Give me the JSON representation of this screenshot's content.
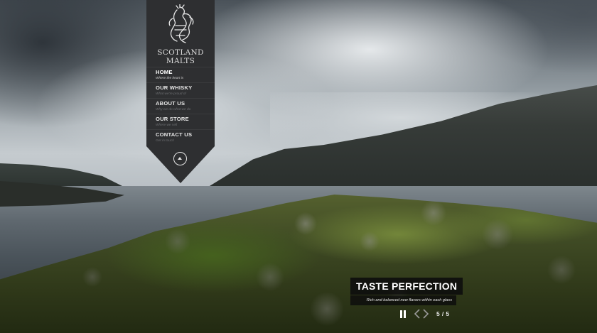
{
  "brand": {
    "name": "SCOTLAND MALTS",
    "emblem": "dragon-emblem"
  },
  "nav": {
    "items": [
      {
        "label": "HOME",
        "sub": "Where the heart is",
        "active": true
      },
      {
        "label": "OUR WHISKY",
        "sub": "What we're proud of",
        "active": false
      },
      {
        "label": "ABOUT US",
        "sub": "Why we do what we do",
        "active": false
      },
      {
        "label": "OUR STORE",
        "sub": "Where we sell",
        "active": false
      },
      {
        "label": "CONTACT US",
        "sub": "Get in touch",
        "active": false
      }
    ],
    "toggle_icon": "chevron-up-icon"
  },
  "slide": {
    "title": "TASTE PERFECTION",
    "subtitle": "Rich and balanced new flavors within each glass",
    "counter": "5 / 5",
    "current": 5,
    "total": 5
  },
  "controls": {
    "pause_icon": "pause-icon",
    "prev_icon": "chevron-left-icon",
    "next_icon": "chevron-right-icon"
  },
  "colors": {
    "ribbon": "#2e2f31",
    "caption_bg": "#0c0c0c",
    "text": "#ffffff"
  }
}
